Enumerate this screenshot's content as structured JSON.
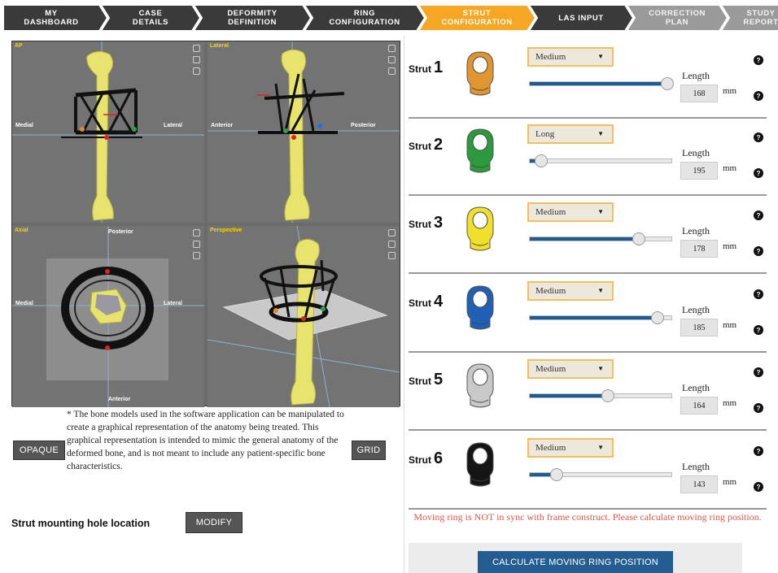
{
  "steps": [
    {
      "line1": "MY",
      "line2": "DASHBOARD"
    },
    {
      "line1": "CASE",
      "line2": "DETAILS"
    },
    {
      "line1": "DEFORMITY",
      "line2": "DEFINITION"
    },
    {
      "line1": "RING",
      "line2": "CONFIGURATION"
    },
    {
      "line1": "STRUT",
      "line2": "CONFIGURATION"
    },
    {
      "line1": "LAS INPUT",
      "line2": ""
    },
    {
      "line1": "CORRECTION",
      "line2": "PLAN"
    },
    {
      "line1": "STUDY",
      "line2": "REPORT"
    }
  ],
  "stepper_colors": {
    "done": "#3a3a3a",
    "active": "#f5a623",
    "pending": "#9a9a9a"
  },
  "viewer": {
    "ap": {
      "title": "AP",
      "left": "Medial",
      "right": "Lateral"
    },
    "lateral": {
      "title": "Lateral",
      "left": "Anterior",
      "right": "Posterior"
    },
    "axial": {
      "title": "Axial",
      "top": "Posterior",
      "bottom": "Anterior",
      "left": "Medial",
      "right": "Lateral"
    },
    "perspective": {
      "title": "Perspective"
    }
  },
  "note": "* The bone models used in the software application can be manipulated to create a graphical representation of the anatomy being treated. This graphical representation is intended to mimic the general anatomy of the deformed bone, and is not meant to include any patient-specific bone characteristics.",
  "buttons": {
    "opaque": "OPAQUE",
    "grid": "GRID",
    "modify": "MODIFY",
    "calculate": "CALCULATE MOVING RING POSITION"
  },
  "mount_label": "Strut mounting hole location",
  "length_label": "Length",
  "mm_label": "mm",
  "strut_label": "Strut",
  "struts": [
    {
      "number": "1",
      "size": "Medium",
      "length": "168",
      "slider_fraction": 0.97,
      "color": "#e0952e"
    },
    {
      "number": "2",
      "size": "Long",
      "length": "195",
      "slider_fraction": 0.08,
      "color": "#2a9a3d"
    },
    {
      "number": "3",
      "size": "Medium",
      "length": "178",
      "slider_fraction": 0.77,
      "color": "#f1e02a"
    },
    {
      "number": "4",
      "size": "Medium",
      "length": "185",
      "slider_fraction": 0.9,
      "color": "#1f5fb5"
    },
    {
      "number": "5",
      "size": "Medium",
      "length": "164",
      "slider_fraction": 0.55,
      "color": "#c8c8c8"
    },
    {
      "number": "6",
      "size": "Medium",
      "length": "143",
      "slider_fraction": 0.19,
      "color": "#151515"
    }
  ],
  "warning": "Moving ring is NOT in sync with frame construct. Please calculate moving ring position."
}
